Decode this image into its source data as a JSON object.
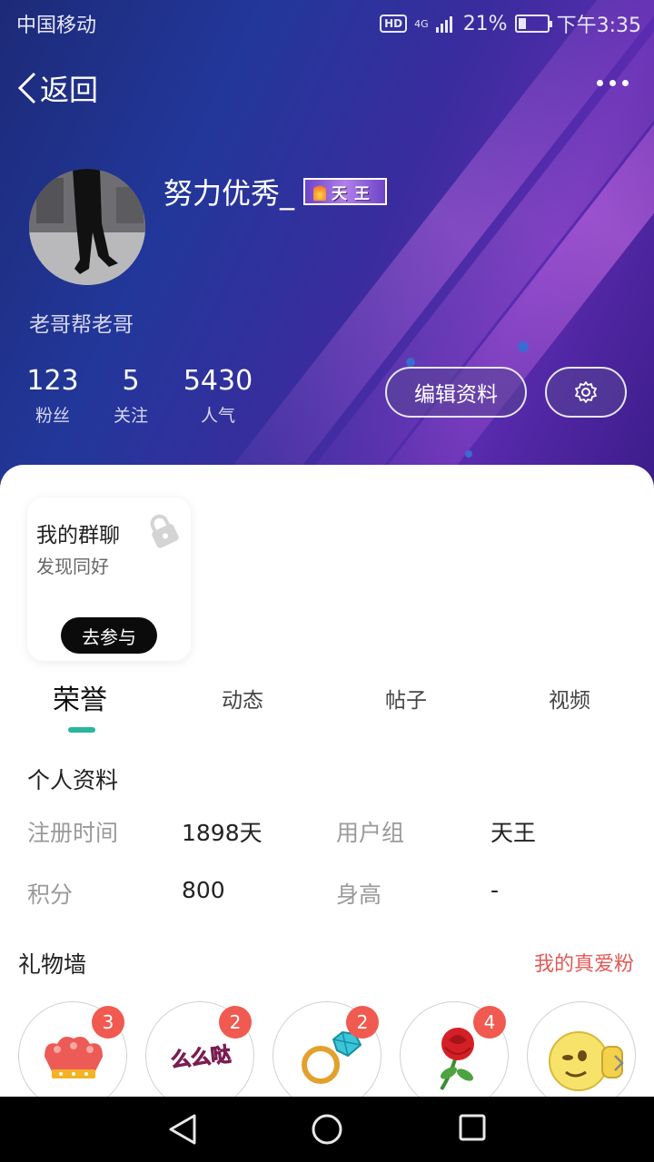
{
  "status_bar": {
    "carrier": "中国移动",
    "hd": "HD",
    "network": "4G",
    "battery": "21%",
    "time": "下午3:35"
  },
  "header": {
    "back_label": "返回",
    "username": "努力优秀_",
    "title_badge": "天王",
    "signature": "老哥帮老哥",
    "stats": [
      {
        "value": "123",
        "label": "粉丝"
      },
      {
        "value": "5",
        "label": "关注"
      },
      {
        "value": "5430",
        "label": "人气"
      }
    ],
    "edit_label": "编辑资料"
  },
  "group_card": {
    "title": "我的群聊",
    "subtitle": "发现同好",
    "join_label": "去参与"
  },
  "tabs": [
    "荣誉",
    "动态",
    "帖子",
    "视频"
  ],
  "profile": {
    "title": "个人资料",
    "rows": [
      {
        "label1": "注册时间",
        "value1": "1898天",
        "label2": "用户组",
        "value2": "天王"
      },
      {
        "label1": "积分",
        "value1": "800",
        "label2": "身高",
        "value2": "-"
      }
    ]
  },
  "gifts": {
    "title": "礼物墙",
    "link": "我的真爱粉",
    "items": [
      {
        "icon": "crown-icon",
        "count": "3"
      },
      {
        "icon": "memeda-sticker-icon",
        "count": "2"
      },
      {
        "icon": "diamond-ring-icon",
        "count": "2"
      },
      {
        "icon": "rose-icon",
        "count": "4"
      },
      {
        "icon": "thumbs-up-emoji-icon",
        "count": ""
      }
    ],
    "sticker_text": "么么哒"
  },
  "colors": {
    "accent_tab": "#2bb59b",
    "gift_badge": "#f05a50",
    "link_red": "#e05a57"
  }
}
